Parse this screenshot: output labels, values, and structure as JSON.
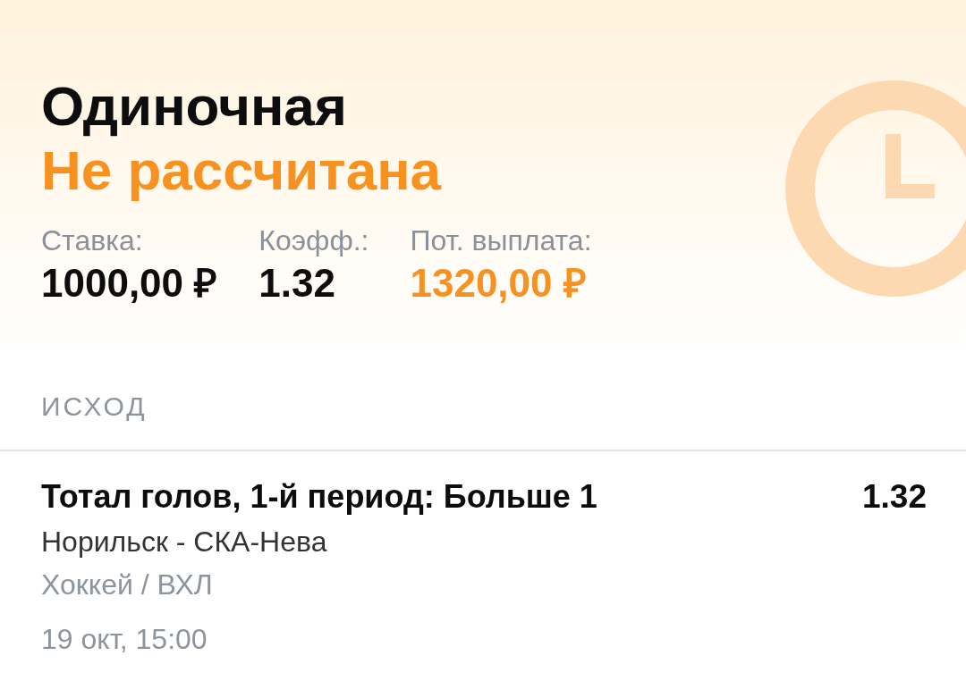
{
  "bet": {
    "type_label": "Одиночная",
    "status": {
      "label": "Не рассчитана",
      "kind": "pending"
    },
    "summary": [
      {
        "label": "Ставка:",
        "value": "1000,00 ₽",
        "highlighted": false
      },
      {
        "label": "Коэфф.:",
        "value": "1.32",
        "highlighted": false
      },
      {
        "label": "Пот. выплата:",
        "value": "1320,00 ₽",
        "highlighted": true
      }
    ]
  },
  "outcome_section": {
    "heading": "ИСХОД",
    "selections": [
      {
        "market": "Тотал голов, 1-й период: Больше 1",
        "odds": "1.32",
        "event": "Норильск - СКА-Нева",
        "league": "Хоккей / ВХЛ",
        "date": "19 окт, 15:00"
      }
    ]
  }
}
